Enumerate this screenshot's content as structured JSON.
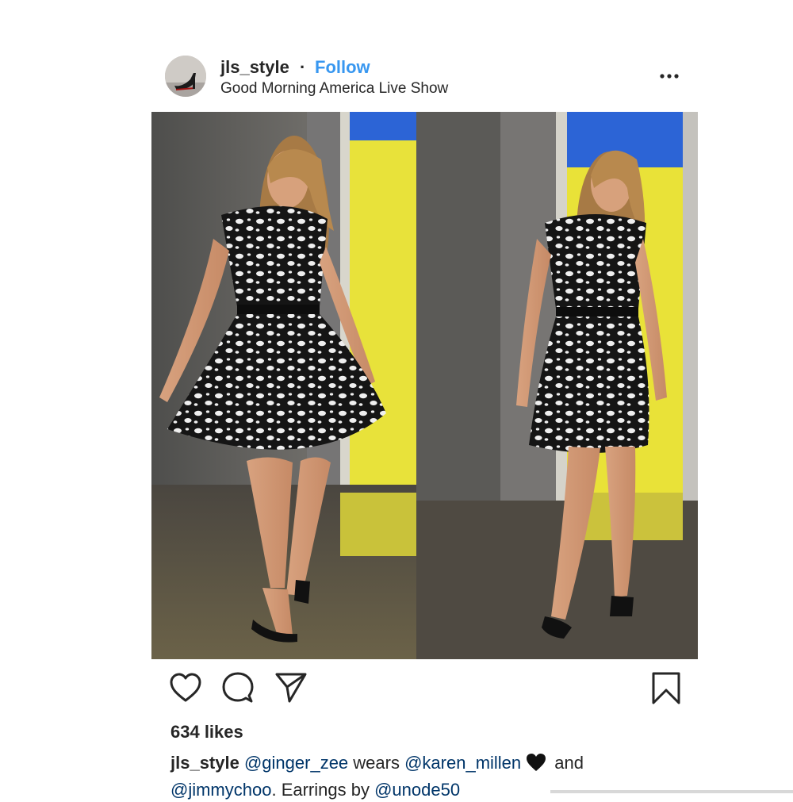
{
  "post": {
    "author": {
      "username": "jls_style",
      "separator": "·",
      "follow_label": "Follow",
      "location": "Good Morning America Live Show",
      "avatar": "avatar-image-red-shoe"
    },
    "menu_icon": "more-options-icon",
    "actions": {
      "like_icon": "heart-icon",
      "comment_icon": "comment-icon",
      "share_icon": "send-icon",
      "save_icon": "bookmark-icon"
    },
    "likes": "634 likes",
    "caption": {
      "username": "jls_style",
      "mention_1": "@ginger_zee",
      "text_1": " wears ",
      "mention_2": "@karen_millen",
      "emoji": "black-heart-emoji",
      "text_2": " and",
      "mention_3": "@jimmychoo",
      "text_3": ". Earrings by ",
      "mention_4": "@unode50"
    }
  },
  "colors": {
    "follow": "#3897f0",
    "text": "#262626",
    "mention": "#003569",
    "background": "#ffffff"
  }
}
